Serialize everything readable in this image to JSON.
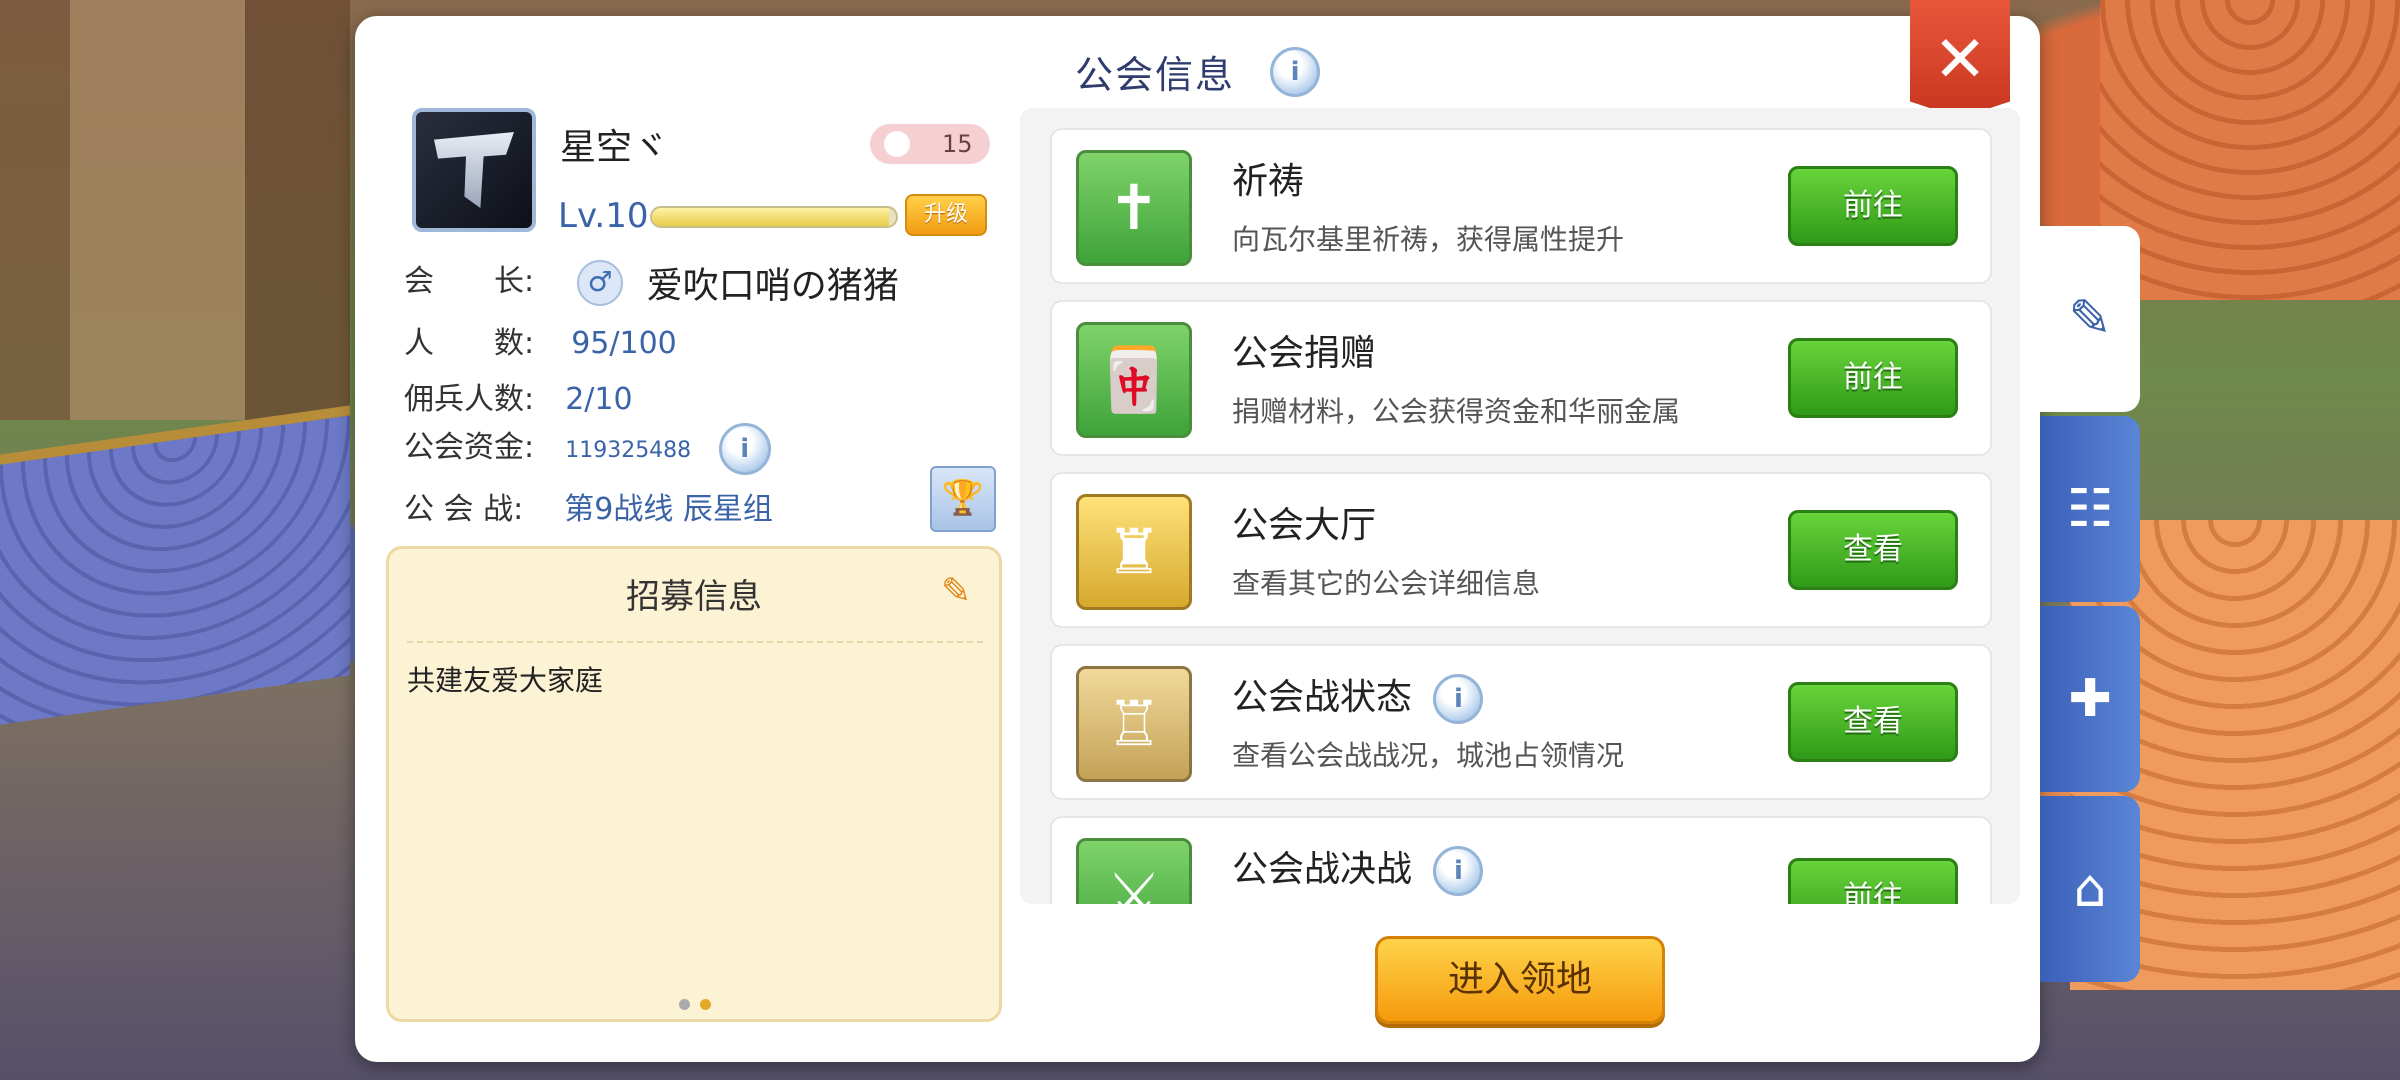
{
  "panel": {
    "title": "公会信息"
  },
  "guild": {
    "name": "星空ヾ",
    "likes": "15",
    "level": "Lv.10",
    "level_progress": 0.97,
    "upgrade_label": "升级",
    "leader_label": "会　　长:",
    "leader_name": "爱吹口哨の猪猪",
    "members_label": "人　　数:",
    "members_value": "95/100",
    "mercenary_label": "佣兵人数:",
    "mercenary_value": "2/10",
    "funds_label": "公会资金:",
    "funds_value": "119325488",
    "war_label": "公 会 战:",
    "war_value": "第9战线 辰星组"
  },
  "recruit": {
    "title": "招募信息",
    "text": "共建友爱大家庭",
    "page_total": 2,
    "page_current": 2
  },
  "activities": [
    {
      "title": "祈祷",
      "desc": "向瓦尔基里祈祷，获得属性提升",
      "button": "前往",
      "icon": "pray-icon"
    },
    {
      "title": "公会捐赠",
      "desc": "捐赠材料，公会获得资金和华丽金属",
      "button": "前往",
      "icon": "donate-icon"
    },
    {
      "title": "公会大厅",
      "desc": "查看其它的公会详细信息",
      "button": "查看",
      "icon": "castle-icon"
    },
    {
      "title": "公会战状态",
      "desc": "查看公会战战况，城池占领情况",
      "button": "查看",
      "icon": "fort-icon"
    },
    {
      "title": "公会战决战",
      "desc": "",
      "button": "前往",
      "icon": "crossed-swords-icon"
    }
  ],
  "enter_button": "进入领地",
  "side_tabs": [
    "edit-icon",
    "contacts-icon",
    "chapel-icon",
    "guild-house-icon"
  ]
}
